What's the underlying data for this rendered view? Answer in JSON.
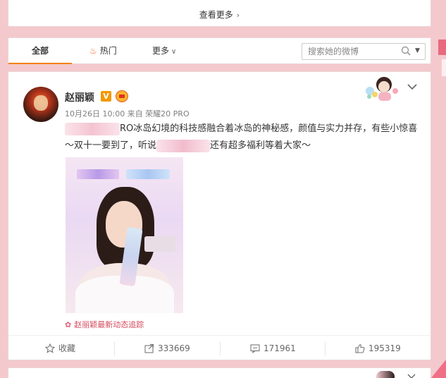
{
  "top_card": {
    "see_more": "查看更多"
  },
  "tabs": [
    {
      "label": "全部"
    },
    {
      "label": "热门"
    },
    {
      "label": "更多"
    }
  ],
  "search": {
    "placeholder": "搜索她的微博"
  },
  "post": {
    "author": "赵丽颖",
    "meta": "10月26日 10:00 来自 荣耀20 PRO",
    "text_part1": "RO冰岛幻境的科技感融合着冰岛的神秘感，颜值与实力并存，有些小惊喜～双十一要到了，听说",
    "text_part2": "还有超多福利等着大家～",
    "dynamic_link": "赵丽颖最新动态追踪",
    "actions": {
      "favorite": "收藏",
      "forward": "333669",
      "comment": "171961",
      "like": "195319"
    }
  },
  "colors": {
    "background": "#f4c9cd",
    "tab_active_underline": "#f28100",
    "verified_badge": "#f39800",
    "link": "#d54a5c"
  },
  "icons": [
    "chevron-right-icon",
    "flame-icon",
    "chevron-down-icon",
    "search-icon",
    "verified-badge-icon",
    "member-crown-icon",
    "star-icon",
    "forward-icon",
    "comment-icon",
    "thumbs-up-icon",
    "flower-icon"
  ]
}
